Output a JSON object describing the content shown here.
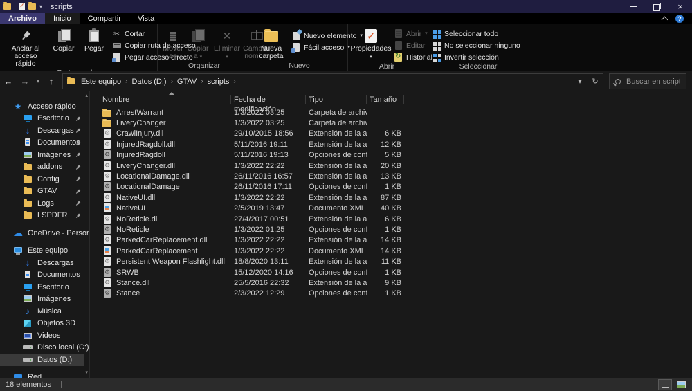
{
  "titlebar": {
    "title": "scripts"
  },
  "tabs": {
    "file": "Archivo",
    "home": "Inicio",
    "share": "Compartir",
    "view": "Vista"
  },
  "icons": {
    "back": "←",
    "forward": "→",
    "up": "↑",
    "dropdown": "▾",
    "up_small": "▴",
    "refresh": "↻",
    "separator": "›",
    "help": "?",
    "cut": "✂",
    "close": "×"
  },
  "ribbon": {
    "clipboard": {
      "group": "Portapapeles",
      "pin": "Anclar al acceso rápido",
      "copy": "Copiar",
      "paste": "Pegar",
      "cut": "Cortar",
      "copy_path": "Copiar ruta de acceso",
      "paste_shortcut": "Pegar acceso directo"
    },
    "organize": {
      "group": "Organizar",
      "move": "Mover a",
      "copy_to": "Copiar a",
      "delete": "Eliminar",
      "delete_x": "✕",
      "rename": "Cambiar nombre"
    },
    "new": {
      "group": "Nuevo",
      "new_folder": "Nueva carpeta",
      "new_item": "Nuevo elemento",
      "easy_access": "Fácil acceso"
    },
    "open": {
      "group": "Abrir",
      "properties": "Propiedades",
      "open": "Abrir",
      "edit": "Editar",
      "history": "Historial"
    },
    "select": {
      "group": "Seleccionar",
      "all": "Seleccionar todo",
      "none": "No seleccionar ninguno",
      "invert": "Invertir selección"
    }
  },
  "nav": {
    "breadcrumb": [
      {
        "label": "Este equipo"
      },
      {
        "label": "Datos (D:)"
      },
      {
        "label": "GTAV"
      },
      {
        "label": "scripts"
      }
    ],
    "search_placeholder": "Buscar en scripts"
  },
  "columns": {
    "name": "Nombre",
    "date": "Fecha de modificación",
    "type": "Tipo",
    "size": "Tamaño"
  },
  "files": [
    {
      "icon": "folder",
      "name": "ArrestWarrant",
      "date": "1/3/2022 03:25",
      "type": "Carpeta de archivos",
      "size": ""
    },
    {
      "icon": "folder",
      "name": "LiveryChanger",
      "date": "1/3/2022 03:25",
      "type": "Carpeta de archivos",
      "size": ""
    },
    {
      "icon": "dll",
      "name": "CrawlInjury.dll",
      "date": "29/10/2015 18:56",
      "type": "Extensión de la ap...",
      "size": "6 KB"
    },
    {
      "icon": "dll",
      "name": "InjuredRagdoll.dll",
      "date": "5/11/2016 19:11",
      "type": "Extensión de la ap...",
      "size": "12 KB"
    },
    {
      "icon": "config",
      "name": "InjuredRagdoll",
      "date": "5/11/2016 19:13",
      "type": "Opciones de confi...",
      "size": "5 KB"
    },
    {
      "icon": "dll",
      "name": "LiveryChanger.dll",
      "date": "1/3/2022 22:22",
      "type": "Extensión de la ap...",
      "size": "20 KB"
    },
    {
      "icon": "dll",
      "name": "LocationalDamage.dll",
      "date": "26/11/2016 16:57",
      "type": "Extensión de la ap...",
      "size": "13 KB"
    },
    {
      "icon": "config",
      "name": "LocationalDamage",
      "date": "26/11/2016 17:11",
      "type": "Opciones de confi...",
      "size": "1 KB"
    },
    {
      "icon": "dll",
      "name": "NativeUI.dll",
      "date": "1/3/2022 22:22",
      "type": "Extensión de la ap...",
      "size": "87 KB"
    },
    {
      "icon": "xml",
      "name": "NativeUI",
      "date": "2/5/2019 13:47",
      "type": "Documento XML",
      "size": "40 KB"
    },
    {
      "icon": "dll",
      "name": "NoReticle.dll",
      "date": "27/4/2017 00:51",
      "type": "Extensión de la ap...",
      "size": "6 KB"
    },
    {
      "icon": "config",
      "name": "NoReticle",
      "date": "1/3/2022 01:25",
      "type": "Opciones de confi...",
      "size": "1 KB"
    },
    {
      "icon": "dll",
      "name": "ParkedCarReplacement.dll",
      "date": "1/3/2022 22:22",
      "type": "Extensión de la ap...",
      "size": "14 KB"
    },
    {
      "icon": "xml",
      "name": "ParkedCarReplacement",
      "date": "1/3/2022 22:22",
      "type": "Documento XML",
      "size": "14 KB"
    },
    {
      "icon": "dll",
      "name": "Persistent Weapon Flashlight.dll",
      "date": "18/8/2020 13:11",
      "type": "Extensión de la ap...",
      "size": "11 KB"
    },
    {
      "icon": "config",
      "name": "SRWB",
      "date": "15/12/2020 14:16",
      "type": "Opciones de confi...",
      "size": "1 KB"
    },
    {
      "icon": "dll",
      "name": "Stance.dll",
      "date": "25/5/2016 22:32",
      "type": "Extensión de la ap...",
      "size": "9 KB"
    },
    {
      "icon": "config",
      "name": "Stance",
      "date": "2/3/2022 12:29",
      "type": "Opciones de confi...",
      "size": "1 KB"
    }
  ],
  "sidebar": {
    "items": [
      {
        "label": "Acceso rápido",
        "icon": "star",
        "cls": "lvl0"
      },
      {
        "label": "Escritorio",
        "icon": "desktop",
        "cls": "lvl1 pinned"
      },
      {
        "label": "Descargas",
        "icon": "download",
        "cls": "lvl1 pinned"
      },
      {
        "label": "Documentos",
        "icon": "document",
        "cls": "lvl1 pinned"
      },
      {
        "label": "Imágenes",
        "icon": "pictures",
        "cls": "lvl1 pinned"
      },
      {
        "label": "addons",
        "icon": "folder",
        "cls": "lvl1 pinned"
      },
      {
        "label": "Config",
        "icon": "folder",
        "cls": "lvl1 pinned"
      },
      {
        "label": "GTAV",
        "icon": "folder",
        "cls": "lvl1 pinned"
      },
      {
        "label": "Logs",
        "icon": "folder",
        "cls": "lvl1 pinned"
      },
      {
        "label": "LSPDFR",
        "icon": "folder",
        "cls": "lvl1 pinned"
      },
      {
        "label": "OneDrive - Personal",
        "icon": "cloud",
        "cls": "lvl0 gap"
      },
      {
        "label": "Este equipo",
        "icon": "computer",
        "cls": "lvl0 gap"
      },
      {
        "label": "Descargas",
        "icon": "download",
        "cls": "lvl1"
      },
      {
        "label": "Documentos",
        "icon": "document",
        "cls": "lvl1"
      },
      {
        "label": "Escritorio",
        "icon": "desktop",
        "cls": "lvl1"
      },
      {
        "label": "Imágenes",
        "icon": "pictures",
        "cls": "lvl1"
      },
      {
        "label": "Música",
        "icon": "music",
        "cls": "lvl1"
      },
      {
        "label": "Objetos 3D",
        "icon": "cube",
        "cls": "lvl1"
      },
      {
        "label": "Videos",
        "icon": "video",
        "cls": "lvl1"
      },
      {
        "label": "Disco local (C:)",
        "icon": "drive",
        "cls": "lvl1"
      },
      {
        "label": "Datos (D:)",
        "icon": "drive",
        "cls": "lvl1 selected"
      },
      {
        "label": "Red",
        "icon": "network",
        "cls": "lvl0 gap"
      }
    ]
  },
  "statusbar": {
    "count": "18 elementos"
  },
  "colors": {
    "titlebar": "#1f1d40",
    "file_tab": "#3b3870",
    "folder_yellow": "#e9bb55",
    "accent_blue": "#2f8ce8",
    "background": "#191919"
  }
}
